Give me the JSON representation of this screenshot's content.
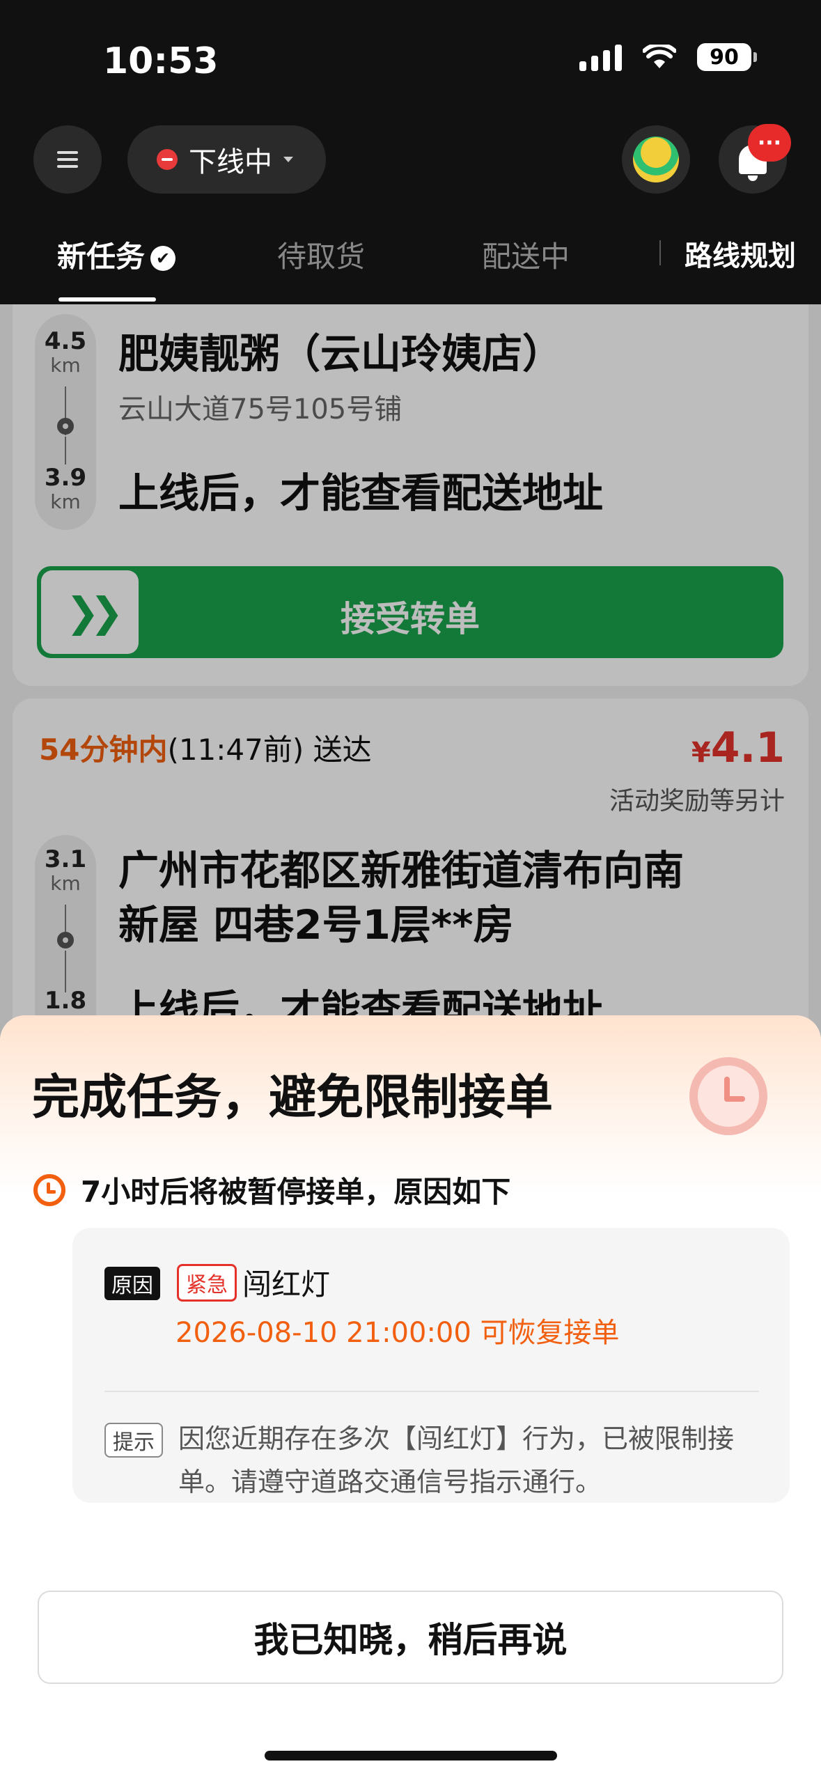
{
  "status_bar": {
    "time": "10:53",
    "battery": "90"
  },
  "header": {
    "status_label": "下线中",
    "notification_badge": "···",
    "tabs": [
      {
        "label": "新任务"
      },
      {
        "label": "待取货"
      },
      {
        "label": "配送中"
      }
    ],
    "route_plan": "路线规划"
  },
  "orders": [
    {
      "pickup_distance_num": "4.5",
      "pickup_distance_unit": "km",
      "delivery_distance_num": "3.9",
      "delivery_distance_unit": "km",
      "shop_name": "肥姨靓粥（云山玲姨店）",
      "shop_address": "云山大道75号105号铺",
      "address_hint": "上线后，才能查看配送地址",
      "accept_label": "接受转单"
    },
    {
      "deliver_time_highlight": "54分钟内",
      "deliver_time_rest": "(11:47前) 送达",
      "price_currency": "¥",
      "price_amount": "4.1",
      "reward_note": "活动奖励等另计",
      "pickup_distance_num": "3.1",
      "pickup_distance_unit": "km",
      "delivery_distance_num": "1.8",
      "shop_name_line1": "广州市花都区新雅街道清布向南",
      "shop_name_line2": "新屋 四巷2号1层**房",
      "address_hint": "上线后，才能查看配送地址"
    }
  ],
  "sheet": {
    "title": "完成任务，避免限制接单",
    "warning": "7小时后将被暂停接单，原因如下",
    "reason_tag": "原因",
    "urgent_tag": "紧急",
    "reason": "闯红灯",
    "recover": "2026-08-10 21:00:00 可恢复接单",
    "tip_tag": "提示",
    "tip": "因您近期存在多次【闯红灯】行为，已被限制接单。请遵守道路交通信号指示通行。",
    "ack_button": "我已知晓，稍后再说"
  },
  "colors": {
    "accent_orange": "#f25f0f",
    "accept_green": "#1aa44c",
    "price_red": "#e4322a"
  },
  "icons": [
    "menu-icon",
    "offline-icon",
    "avatar-icon",
    "bell-icon",
    "check-icon",
    "pin-icon",
    "double-chevron-icon",
    "clock-icon"
  ]
}
